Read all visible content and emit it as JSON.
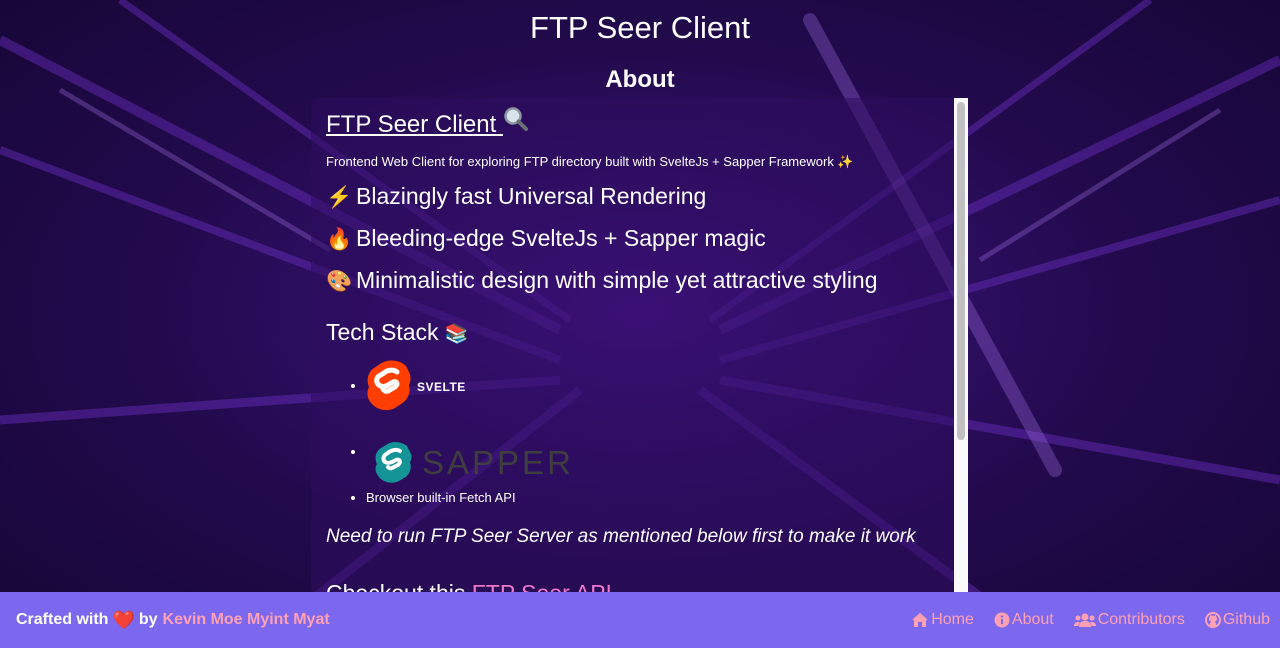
{
  "site": {
    "title": "FTP Seer Client"
  },
  "page": {
    "heading": "About"
  },
  "readme": {
    "title": "FTP Seer Client",
    "title_icon": "magnifier-icon",
    "tagline": "Frontend Web Client for exploring FTP directory built with SvelteJs + Sapper Framework ✨",
    "features": [
      {
        "emoji": "⚡",
        "text": "Blazingly fast Universal Rendering"
      },
      {
        "emoji": "🔥",
        "text": "Bleeding-edge SvelteJs + Sapper magic"
      },
      {
        "emoji": "🎨",
        "text": "Minimalistic design with simple yet attractive styling"
      }
    ],
    "tech_stack_title": "Tech Stack",
    "tech_stack_emoji": "📚",
    "tech": {
      "svelte_word": "SVELTE",
      "sapper_word": "SAPPER",
      "fetch": "Browser built-in Fetch API"
    },
    "note": "Need to run FTP Seer Server as mentioned below first to make it work",
    "checkout_prefix": "Checkout this ",
    "checkout_link": "FTP Seer API"
  },
  "footer": {
    "crafted": "Crafted with",
    "heart": "❤️",
    "by": "by",
    "author": "Kevin Moe Myint Myat",
    "nav": {
      "home": "Home",
      "about": "About",
      "contributors": "Contributors",
      "github": "Github"
    }
  },
  "colors": {
    "footer_bg": "#7b68ee",
    "link_pink": "#ffa0b4",
    "svelte_orange": "#ff3e00",
    "sapper_teal": "#159497"
  }
}
